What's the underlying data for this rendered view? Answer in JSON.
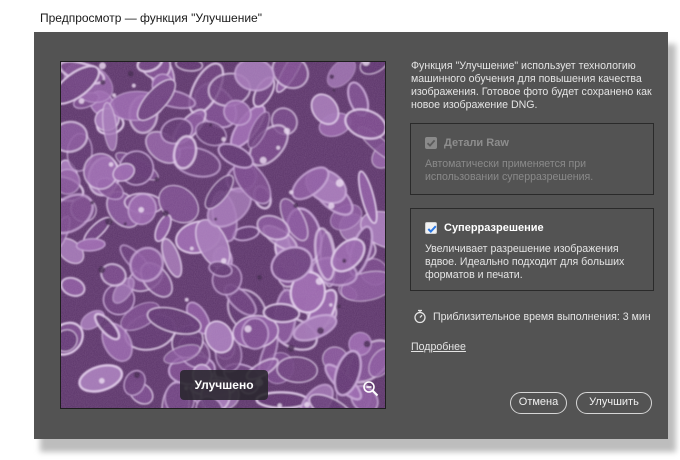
{
  "window": {
    "title": "Предпросмотр — функция \"Улучшение\""
  },
  "preview": {
    "badge_label": "Улучшено",
    "zoom_icon": "zoom-out-icon"
  },
  "description": "Функция \"Улучшение\" использует технологию машинного обучения для повышения качества изображения. Готовое фото будет сохранено как новое изображение DNG.",
  "options": {
    "raw_details": {
      "label": "Детали Raw",
      "checked": true,
      "disabled": true,
      "description": "Автоматически применяется при использовании суперразрешения."
    },
    "super_resolution": {
      "label": "Суперразрешение",
      "checked": true,
      "disabled": false,
      "description": "Увеличивает разрешение изображения вдвое. Идеально подходит для больших форматов и печати."
    }
  },
  "estimate": {
    "icon": "stopwatch-icon",
    "text": "Приблизительное время выполнения: 3 мин"
  },
  "learn_more": "Подробнее",
  "buttons": {
    "cancel": "Отмена",
    "enhance": "Улучшить"
  },
  "colors": {
    "dialog_bg": "#535353",
    "checkbox_check": "#2b78e4"
  }
}
